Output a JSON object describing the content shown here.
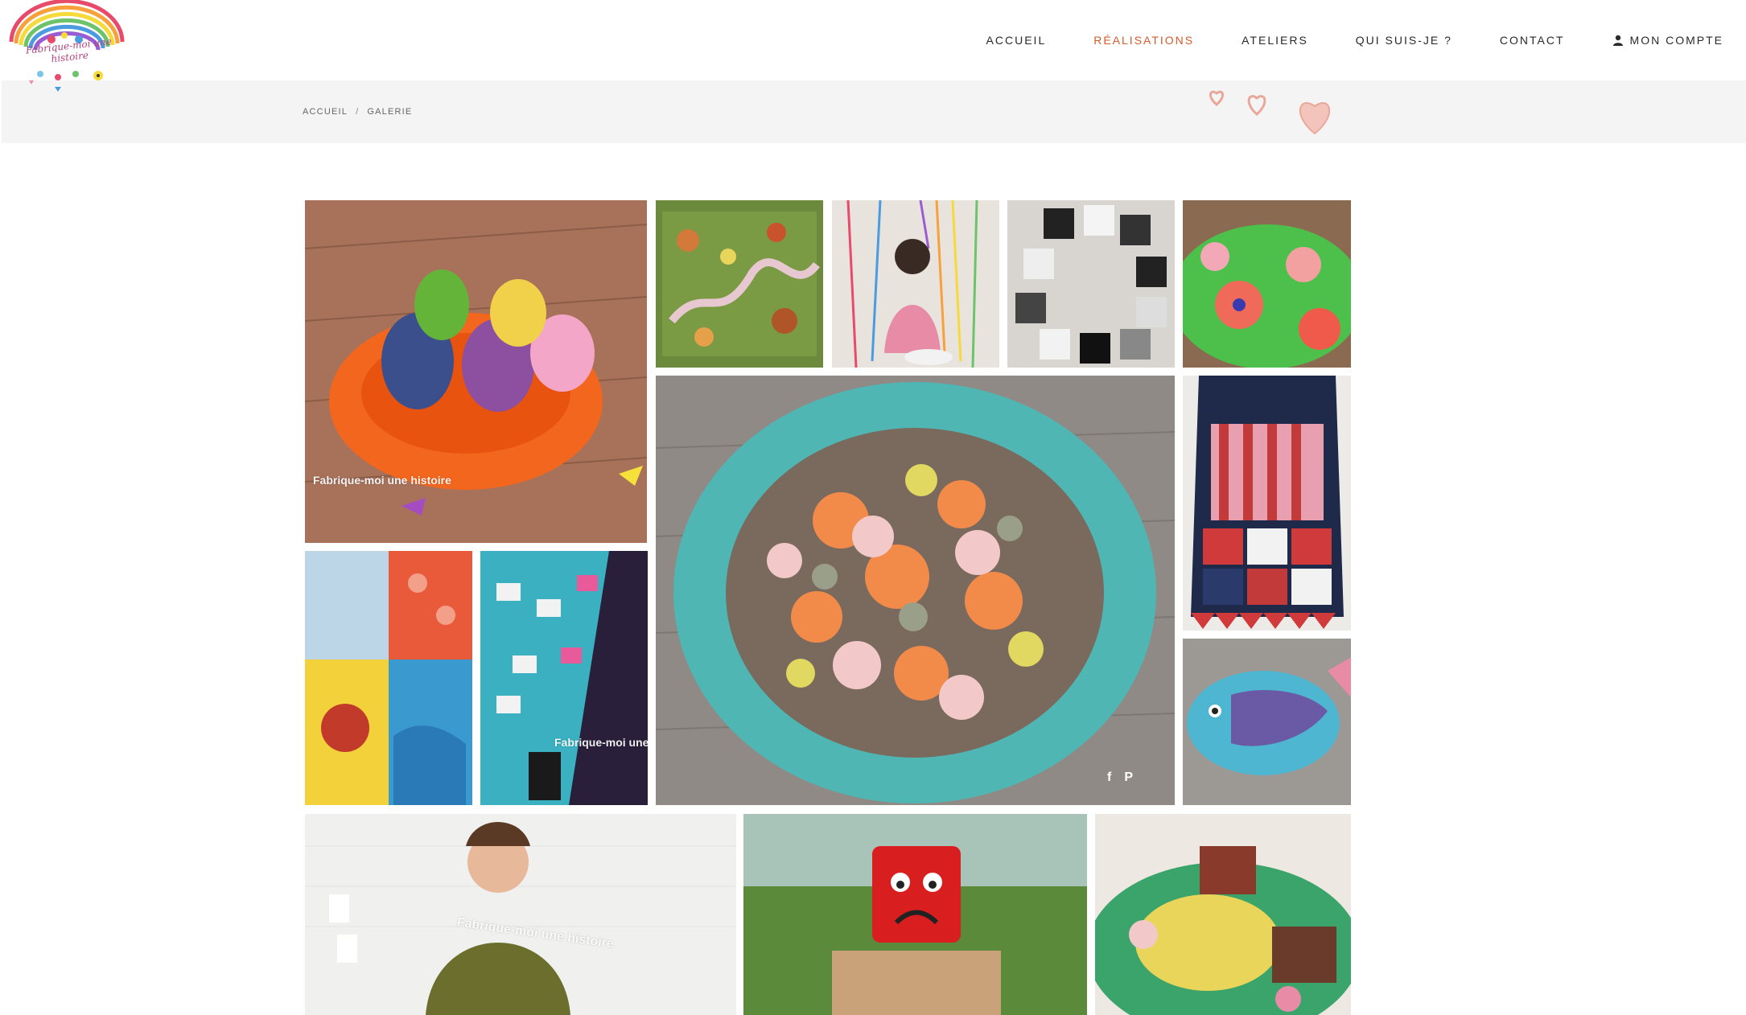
{
  "header": {
    "logo_text": "Fabrique-moi une histoire",
    "nav": [
      {
        "label": "ACCUEIL",
        "active": false
      },
      {
        "label": "RÉALISATIONS",
        "active": true
      },
      {
        "label": "ATELIERS",
        "active": false
      },
      {
        "label": "QUI SUIS-JE ?",
        "active": false
      },
      {
        "label": "CONTACT",
        "active": false
      },
      {
        "label": "MON COMPTE",
        "active": false,
        "icon": "user-icon"
      }
    ],
    "accent_color": "#d35b2c"
  },
  "breadcrumb": {
    "home": "ACCUEIL",
    "separator": "/",
    "current": "GALERIE"
  },
  "gallery": {
    "watermark": "Fabrique-moi une histoire",
    "watermark_short": "Fabrique-moi une",
    "watermark_url": "fabriquemoiunehistoire.fr",
    "share_icons": [
      "facebook-icon",
      "pinterest-icon"
    ],
    "share_glyphs": [
      "f",
      "P"
    ]
  }
}
